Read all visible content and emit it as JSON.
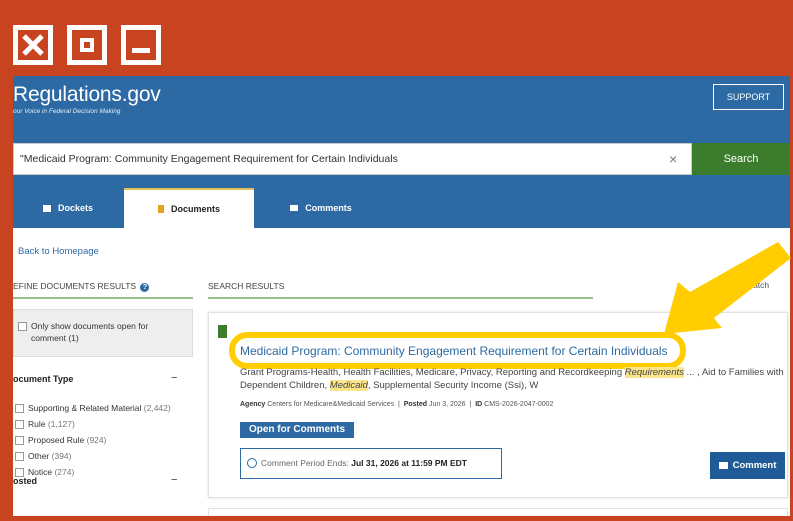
{
  "window_controls": {
    "close_icon": "close-icon",
    "maximize_icon": "maximize-icon",
    "minimize_icon": "minimize-icon",
    "frame_color": "#c8431f"
  },
  "site": {
    "logo": "Regulations.gov",
    "tagline": "our Voice in Federal Decision Making",
    "support_label": "SUPPORT",
    "brand_color": "#2d6aa3"
  },
  "search": {
    "query": "\"Medicaid Program: Community Engagement Requirement for Certain Individuals",
    "clear_icon": "×",
    "button_label": "Search"
  },
  "tabs": [
    {
      "label": "Dockets",
      "icon": "folder-icon"
    },
    {
      "label": "Documents",
      "icon": "document-icon",
      "selected": true
    },
    {
      "label": "Comments",
      "icon": "comment-icon"
    }
  ],
  "back_link": "Back to Homepage",
  "sidebar": {
    "refine_label": "EFINE DOCUMENTS RESULTS",
    "open_only_label": "Only show documents open for comment",
    "open_only_count": "(1)",
    "document_type_title": "ocument Type",
    "collapse_symbol": "−",
    "filters": [
      {
        "label": "Supporting & Related Material",
        "count": "(2,442)"
      },
      {
        "label": "Rule",
        "count": "(1,127)"
      },
      {
        "label": "Proposed Rule",
        "count": "(924)"
      },
      {
        "label": "Other",
        "count": "(394)"
      },
      {
        "label": "Notice",
        "count": "(274)"
      }
    ],
    "posted_title": "osted"
  },
  "results": {
    "label": "SEARCH RESULTS",
    "sort_text": "Match",
    "card": {
      "title": "Medicaid Program: Community Engagement Requirement for Certain Individuals",
      "topics_line1_a": "Grant Programs-Health, Health Facilities, Medicare, Privacy, Reporting and Recordkeeping ",
      "topics_line1_hl": "Requirements",
      "topics_line1_b": " ... , Aid to Families with",
      "topics_line2_a": "Dependent Children, ",
      "topics_line2_hl": "Medicaid",
      "topics_line2_b": ", Supplemental Security Income (Ssi), W",
      "agency_label": "Agency",
      "agency_value": "Centers for Medicare&Medicaid Services",
      "posted_label": "Posted",
      "posted_value": "Jun 3, 2026",
      "id_label": "ID",
      "id_value": "CMS-2026-2047-0002",
      "status_badge": "Open for Comments",
      "period_label": "Comment Period Ends:",
      "period_value": "Jul 31, 2026 at 11:59 PM EDT",
      "comment_button": "Comment"
    }
  },
  "annotation": {
    "highlight_color": "#ffcd00",
    "arrow_icon": "pointer-arrow-icon"
  }
}
